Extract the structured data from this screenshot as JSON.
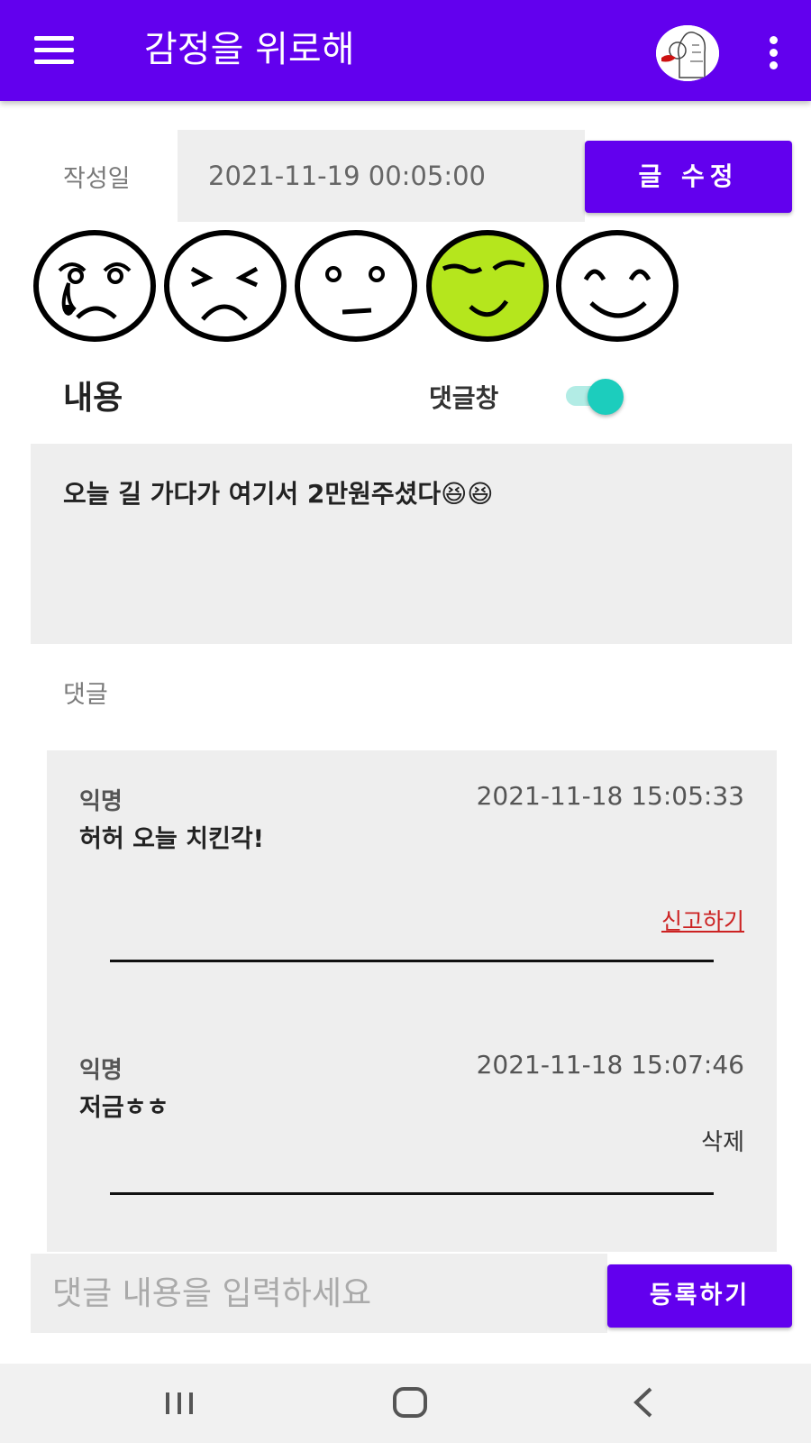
{
  "app_bar": {
    "title": "감정을 위로해"
  },
  "post": {
    "date_label": "작성일",
    "date_value": "2021-11-19 00:05:00",
    "edit_button": "글 수정",
    "content_label": "내용",
    "comment_toggle_label": "댓글창",
    "comment_toggle_on": true,
    "content_text": "오늘 길 가다가 여기서 2만원주셨다😆😆"
  },
  "emotions": [
    {
      "icon": "crying-face-icon",
      "selected": false
    },
    {
      "icon": "frustrated-face-icon",
      "selected": false
    },
    {
      "icon": "neutral-face-icon",
      "selected": false
    },
    {
      "icon": "smirking-face-icon",
      "selected": true,
      "color": "#B5E61D"
    },
    {
      "icon": "happy-face-icon",
      "selected": false
    }
  ],
  "comments": {
    "header": "댓글",
    "items": [
      {
        "author": "익명",
        "timestamp": "2021-11-18 15:05:33",
        "text": "허허 오늘 치킨각!",
        "action": "신고하기"
      },
      {
        "author": "익명",
        "timestamp": "2021-11-18 15:07:46",
        "text": "저금ㅎㅎ",
        "action": "삭제"
      }
    ]
  },
  "comment_input": {
    "placeholder": "댓글 내용을 입력하세요",
    "value": "",
    "submit_label": "등록하기"
  },
  "colors": {
    "primary": "#6200EE",
    "toggle_accent": "#1CCDBD",
    "report_red": "#CC2222",
    "selected_emotion": "#B5E61D"
  }
}
